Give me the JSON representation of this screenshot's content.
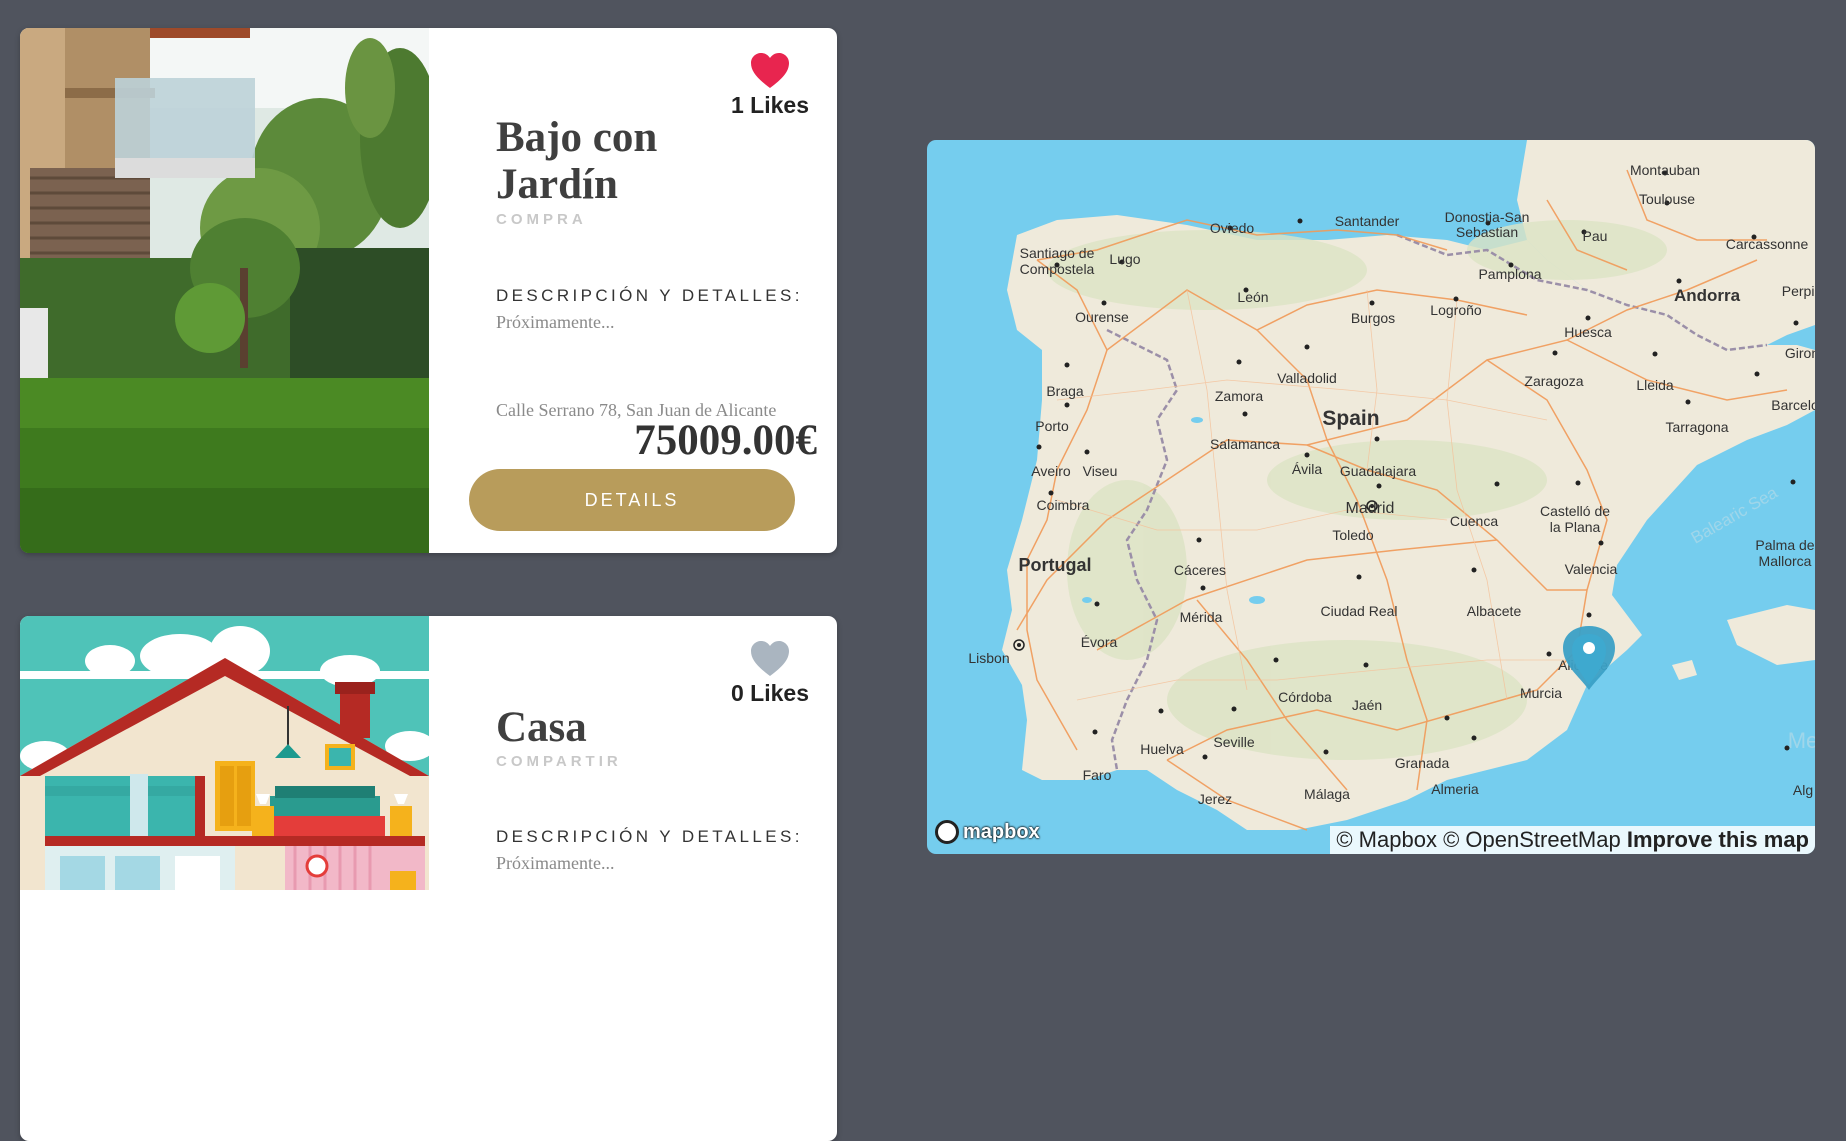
{
  "listings": [
    {
      "title": "Bajo con Jardín",
      "type": "COMPRA",
      "likes": "1 Likes",
      "liked": true,
      "desc_heading": "DESCRIPCIÓN Y DETALLES:",
      "desc_text": "Próximamente...",
      "address": "Calle Serrano 78, San Juan de Alicante",
      "price": "75009.00€",
      "button": "DETAILS"
    },
    {
      "title": "Casa",
      "type": "COMPARTIR",
      "likes": "0 Likes",
      "liked": false,
      "desc_heading": "DESCRIPCIÓN Y DETALLES:",
      "desc_text": "Próximamente..."
    }
  ],
  "colors": {
    "background": "#50545e",
    "liked_heart": "#e8254f",
    "unliked_heart": "#aab5c0",
    "button": "#b89c5b",
    "sea": "#75cdee",
    "land": "#efeadb"
  },
  "map": {
    "labels": {
      "montauban": "Montauban",
      "toulouse": "Toulouse",
      "santander": "Santander",
      "donostia": "Donostia-San",
      "sebastian": "Sebastian",
      "oviedo": "Oviedo",
      "pau": "Pau",
      "carcassonne": "Carcassonne",
      "santiago": "Santiago de",
      "compostela": "Compostela",
      "lugo": "Lugo",
      "pamplona": "Pamplona",
      "andorra": "Andorra",
      "perpignan": "Perpig",
      "leon": "León",
      "ourense": "Ourense",
      "burgos": "Burgos",
      "logrono": "Logroño",
      "huesca": "Huesca",
      "girona": "Giron",
      "braga": "Braga",
      "valladolid": "Valladolid",
      "zaragoza": "Zaragoza",
      "lleida": "Lleida",
      "barcelona": "Barcelo",
      "porto": "Porto",
      "zamora": "Zamora",
      "spain": "Spain",
      "salamanca": "Salamanca",
      "tarragona": "Tarragona",
      "aveiro": "Aveiro",
      "viseu": "Viseu",
      "avila": "Ávila",
      "guadalajara": "Guadalajara",
      "madrid": "Madrid",
      "balearic_sea": "Balearic Sea",
      "coimbra": "Coimbra",
      "castellon": "Castelló de",
      "la_plana": "la Plana",
      "toledo": "Toledo",
      "cuenca": "Cuenca",
      "palma": "Palma de",
      "mallorca": "Mallorca",
      "portugal": "Portugal",
      "caceres": "Cáceres",
      "valencia": "Valencia",
      "merida": "Mérida",
      "ciudad_real": "Ciudad Real",
      "albacete": "Albacete",
      "lisbon": "Lisbon",
      "evora": "Évora",
      "alicante": "Alicante",
      "murcia": "Murcia",
      "cordoba": "Córdoba",
      "jaen": "Jaén",
      "huelva": "Huelva",
      "seville": "Seville",
      "med": "Me",
      "faro": "Faro",
      "granada": "Granada",
      "almeria": "Almeria",
      "alg": "Alg",
      "jerez": "Jerez",
      "malaga": "Málaga"
    },
    "logo": "mapbox",
    "attribution_mapbox": "© Mapbox",
    "attribution_osm": "© OpenStreetMap",
    "attribution_improve": "Improve this map"
  }
}
